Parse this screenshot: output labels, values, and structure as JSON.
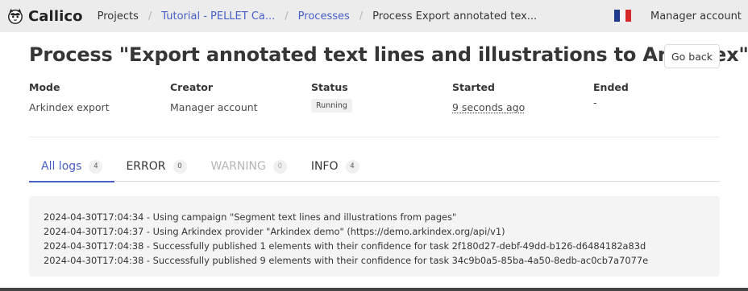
{
  "app": {
    "name": "Callico"
  },
  "breadcrumb": [
    {
      "label": "Projects",
      "kind": "link"
    },
    {
      "label": "Tutorial - PELLET Ca...",
      "kind": "link"
    },
    {
      "label": "Processes",
      "kind": "link"
    },
    {
      "label": "Process Export annotated tex...",
      "kind": "current"
    }
  ],
  "header": {
    "language_flag": "french-flag-icon",
    "account_label": "Manager account",
    "title": "Process \"Export annotated text lines and illustrations to Arkindex\"",
    "back_label": "Go back"
  },
  "info": {
    "mode": {
      "label": "Mode",
      "value": "Arkindex export"
    },
    "creator": {
      "label": "Creator",
      "value": "Manager account"
    },
    "status": {
      "label": "Status",
      "value": "Running"
    },
    "started": {
      "label": "Started",
      "value": "9 seconds ago"
    },
    "ended": {
      "label": "Ended",
      "value": "-"
    }
  },
  "tabs": [
    {
      "label": "All logs",
      "count": "4",
      "state": "active"
    },
    {
      "label": "ERROR",
      "count": "0",
      "state": "normal"
    },
    {
      "label": "WARNING",
      "count": "0",
      "state": "disabled"
    },
    {
      "label": "INFO",
      "count": "4",
      "state": "normal"
    }
  ],
  "logs": [
    "2024-04-30T17:04:34 - Using campaign \"Segment text lines and illustrations from pages\"",
    "2024-04-30T17:04:37 - Using Arkindex provider \"Arkindex demo\" (https://demo.arkindex.org/api/v1)",
    "2024-04-30T17:04:38 - Successfully published 1 elements with their confidence for task 2f180d27-debf-49dd-b126-d6484182a83d",
    "2024-04-30T17:04:38 - Successfully published 9 elements with their confidence for task 34c9b0a5-85ba-4a50-8edb-ac0cb7a7077e"
  ],
  "colors": {
    "accent": "#485fc7",
    "navbar": "#ececec",
    "logbox": "#f4f4f4"
  }
}
